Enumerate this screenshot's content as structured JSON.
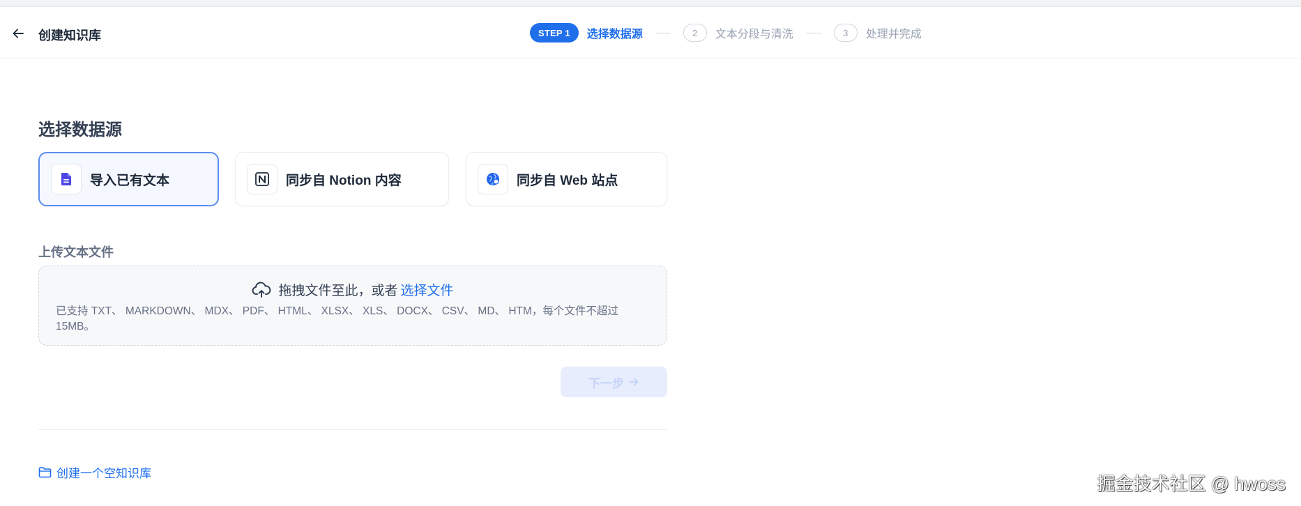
{
  "header": {
    "back_icon": "arrow-left-icon",
    "title": "创建知识库"
  },
  "steps": [
    {
      "badge": "STEP 1",
      "label": "选择数据源",
      "state": "active"
    },
    {
      "badge": "2",
      "label": "文本分段与清洗",
      "state": "pending"
    },
    {
      "badge": "3",
      "label": "处理并完成",
      "state": "pending"
    }
  ],
  "main": {
    "section_title": "选择数据源",
    "sources": [
      {
        "label": "导入已有文本",
        "icon": "file-text-icon",
        "selected": true
      },
      {
        "label": "同步自 Notion 内容",
        "icon": "notion-icon",
        "selected": false
      },
      {
        "label": "同步自 Web 站点",
        "icon": "globe-icon",
        "selected": false
      }
    ],
    "upload": {
      "title": "上传文本文件",
      "drag_text": "拖拽文件至此，或者",
      "select_link": "选择文件",
      "support_text": "已支持 TXT、 MARKDOWN、 MDX、 PDF、 HTML、 XLSX、 XLS、 DOCX、 CSV、 MD、 HTM，每个文件不超过 15MB。"
    },
    "next_button": "下一步",
    "empty_kb_link": "创建一个空知识库"
  },
  "watermark": "掘金技术社区 @ hwoss",
  "colors": {
    "accent": "#1f6feb",
    "muted": "#98a2b3",
    "disabled_bg": "#e7edfd"
  }
}
